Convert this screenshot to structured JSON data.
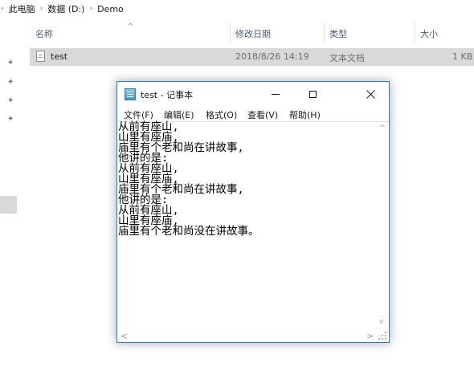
{
  "breadcrumb": {
    "items": [
      "此电脑",
      "数据 (D:)",
      "Demo"
    ]
  },
  "columns": {
    "name": "名称",
    "modified": "修改日期",
    "type": "类型",
    "size": "大小"
  },
  "file": {
    "name": "test",
    "modified": "2018/8/26 14:19",
    "type": "文本文档",
    "size": "1 KB"
  },
  "notepad": {
    "title": "test - 记事本",
    "menu": [
      "文件(F)",
      "编辑(E)",
      "格式(O)",
      "查看(V)",
      "帮助(H)"
    ],
    "content": "从前有座山,\n山里有座庙,\n庙里有个老和尚在讲故事,\n他讲的是:\n从前有座山,\n山里有座庙,\n庙里有个老和尚在讲故事,\n他讲的是:\n从前有座山,\n山里有座庙,\n庙里有个老和尚没在讲故事。"
  }
}
